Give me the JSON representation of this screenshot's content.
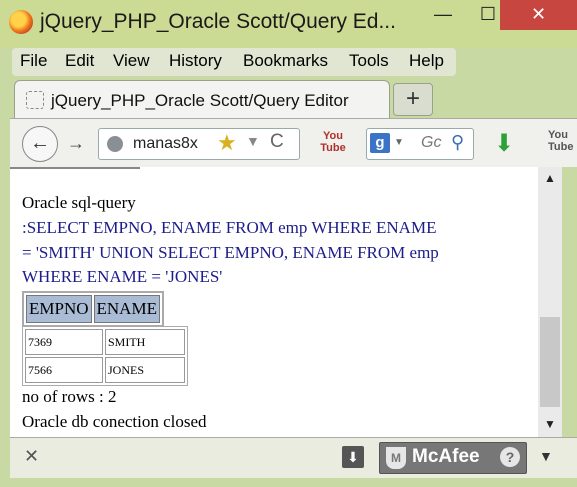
{
  "window": {
    "title": "jQuery_PHP_Oracle Scott/Query Ed...",
    "minimize": "—",
    "maximize": "☐",
    "close": "✕"
  },
  "menu": [
    "File",
    "Edit",
    "View",
    "History",
    "Bookmarks",
    "Tools",
    "Help"
  ],
  "tab": {
    "title": "jQuery_PHP_Oracle Scott/Query Editor",
    "new_tab": "+"
  },
  "nav": {
    "back": "←",
    "forward": "→",
    "url": "manas8x",
    "star": "★",
    "reload": "C",
    "youtube_label": "You Tube",
    "search_engine": "g",
    "search_placeholder": "Gc",
    "download": "⬇",
    "youtube2_label": "You Tube"
  },
  "page": {
    "heading": "Oracle sql-query",
    "query_lines": [
      ":SELECT EMPNO, ENAME FROM emp WHERE ENAME",
      "= 'SMITH' UNION SELECT EMPNO, ENAME FROM emp",
      "WHERE ENAME = 'JONES'"
    ],
    "table": {
      "headers": [
        "EMPNO",
        "ENAME"
      ],
      "rows": [
        [
          "7369",
          "SMITH"
        ],
        [
          "7566",
          "JONES"
        ]
      ]
    },
    "row_count": "no of rows : 2",
    "closed_msg": "Oracle db conection closed"
  },
  "addon_bar": {
    "close": "✕",
    "mcafee": "McAfee",
    "help": "?"
  },
  "colors": {
    "chrome": "#cbdb93",
    "close_button": "#c7463f",
    "query_text": "#1c1c8a",
    "table_header": "#a9bbd5"
  }
}
